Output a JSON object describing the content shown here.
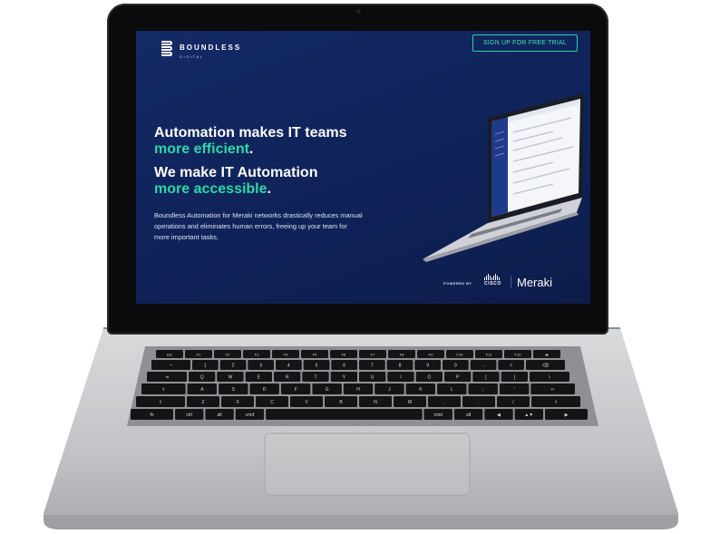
{
  "site": {
    "brand_name": "BOUNDLESS",
    "brand_sub": "DIGITAL",
    "cta_label": "SIGN UP FOR FREE TRIAL",
    "headline1_white": "Automation makes IT teams",
    "headline1_green": "more efficient",
    "headline1_tail": ".",
    "headline2_white": "We make IT Automation",
    "headline2_green": "more accessible",
    "headline2_tail": ".",
    "description": "Boundless Automation for Meraki networks drastically reduces manual operations and eliminates human errors, freeing up your team for more important tasks.",
    "powered_by": "POWERED BY",
    "cisco_wordmark": "CISCO",
    "partner_name": "Meraki"
  },
  "colors": {
    "screen_bg": "#0f2258",
    "accent_green": "#2fd6a6",
    "laptop_silver": "#c9cacc",
    "bezel": "#0b0b0d"
  },
  "keyboard": {
    "row1": [
      "esc",
      "F1",
      "F2",
      "F3",
      "F4",
      "F5",
      "F6",
      "F7",
      "F8",
      "F9",
      "F10",
      "F11",
      "F12",
      "⏏"
    ],
    "row2": [
      "~",
      "1",
      "2",
      "3",
      "4",
      "5",
      "6",
      "7",
      "8",
      "9",
      "0",
      "-",
      "=",
      "⌫"
    ],
    "row3": [
      "⇥",
      "Q",
      "W",
      "E",
      "R",
      "T",
      "Y",
      "U",
      "I",
      "O",
      "P",
      "[",
      "]",
      "\\"
    ],
    "row4": [
      "⇪",
      "A",
      "S",
      "D",
      "F",
      "G",
      "H",
      "J",
      "K",
      "L",
      ";",
      "'",
      "↵"
    ],
    "row5": [
      "⇧",
      "Z",
      "X",
      "C",
      "V",
      "B",
      "N",
      "M",
      ",",
      ".",
      "/",
      "⇧"
    ],
    "row6": [
      "fn",
      "ctrl",
      "alt",
      "cmd",
      "",
      "cmd",
      "alt",
      "◀",
      "▲▼",
      "▶"
    ]
  }
}
